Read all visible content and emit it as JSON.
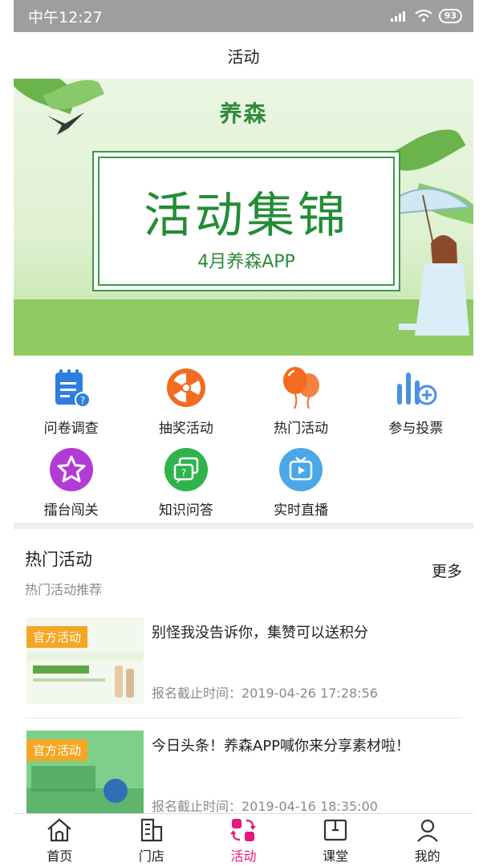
{
  "status": {
    "time": "中午12:27",
    "battery": "93"
  },
  "header": {
    "title": "活动"
  },
  "banner": {
    "brand": "养森",
    "headline": "活动集锦",
    "subline": "4月养森APP"
  },
  "quick_actions": [
    {
      "label": "问卷调查",
      "icon": "survey-icon",
      "color": "#2f7de1"
    },
    {
      "label": "抽奖活动",
      "icon": "lottery-wheel-icon",
      "color": "#f26b21"
    },
    {
      "label": "热门活动",
      "icon": "balloons-icon",
      "color": "#f26b21"
    },
    {
      "label": "参与投票",
      "icon": "vote-icon",
      "color": "#4a90e2"
    },
    {
      "label": "擂台闯关",
      "icon": "star-challenge-icon",
      "color": "#b23bd6"
    },
    {
      "label": "知识问答",
      "icon": "qa-icon",
      "color": "#2fb34a"
    },
    {
      "label": "实时直播",
      "icon": "live-tv-icon",
      "color": "#4aa8e8"
    }
  ],
  "hot": {
    "heading": "热门活动",
    "subheading": "热门活动推荐",
    "more": "更多",
    "items": [
      {
        "tag": "官方活动",
        "title": "别怪我没告诉你，集赞可以送积分",
        "deadline": "报名截止时间：2019-04-26 17:28:56"
      },
      {
        "tag": "官方活动",
        "title": "今日头条！养森APP喊你来分享素材啦！",
        "deadline": "报名截止时间：2019-04-16 18:35:00"
      }
    ]
  },
  "tabs": [
    {
      "label": "首页",
      "icon": "home-icon"
    },
    {
      "label": "门店",
      "icon": "store-icon"
    },
    {
      "label": "活动",
      "icon": "activity-icon",
      "active": true
    },
    {
      "label": "课堂",
      "icon": "classroom-icon"
    },
    {
      "label": "我的",
      "icon": "profile-icon"
    }
  ],
  "colors": {
    "accent": "#e6197a",
    "tag": "#f5a623",
    "brand_green": "#2e8b3a"
  }
}
